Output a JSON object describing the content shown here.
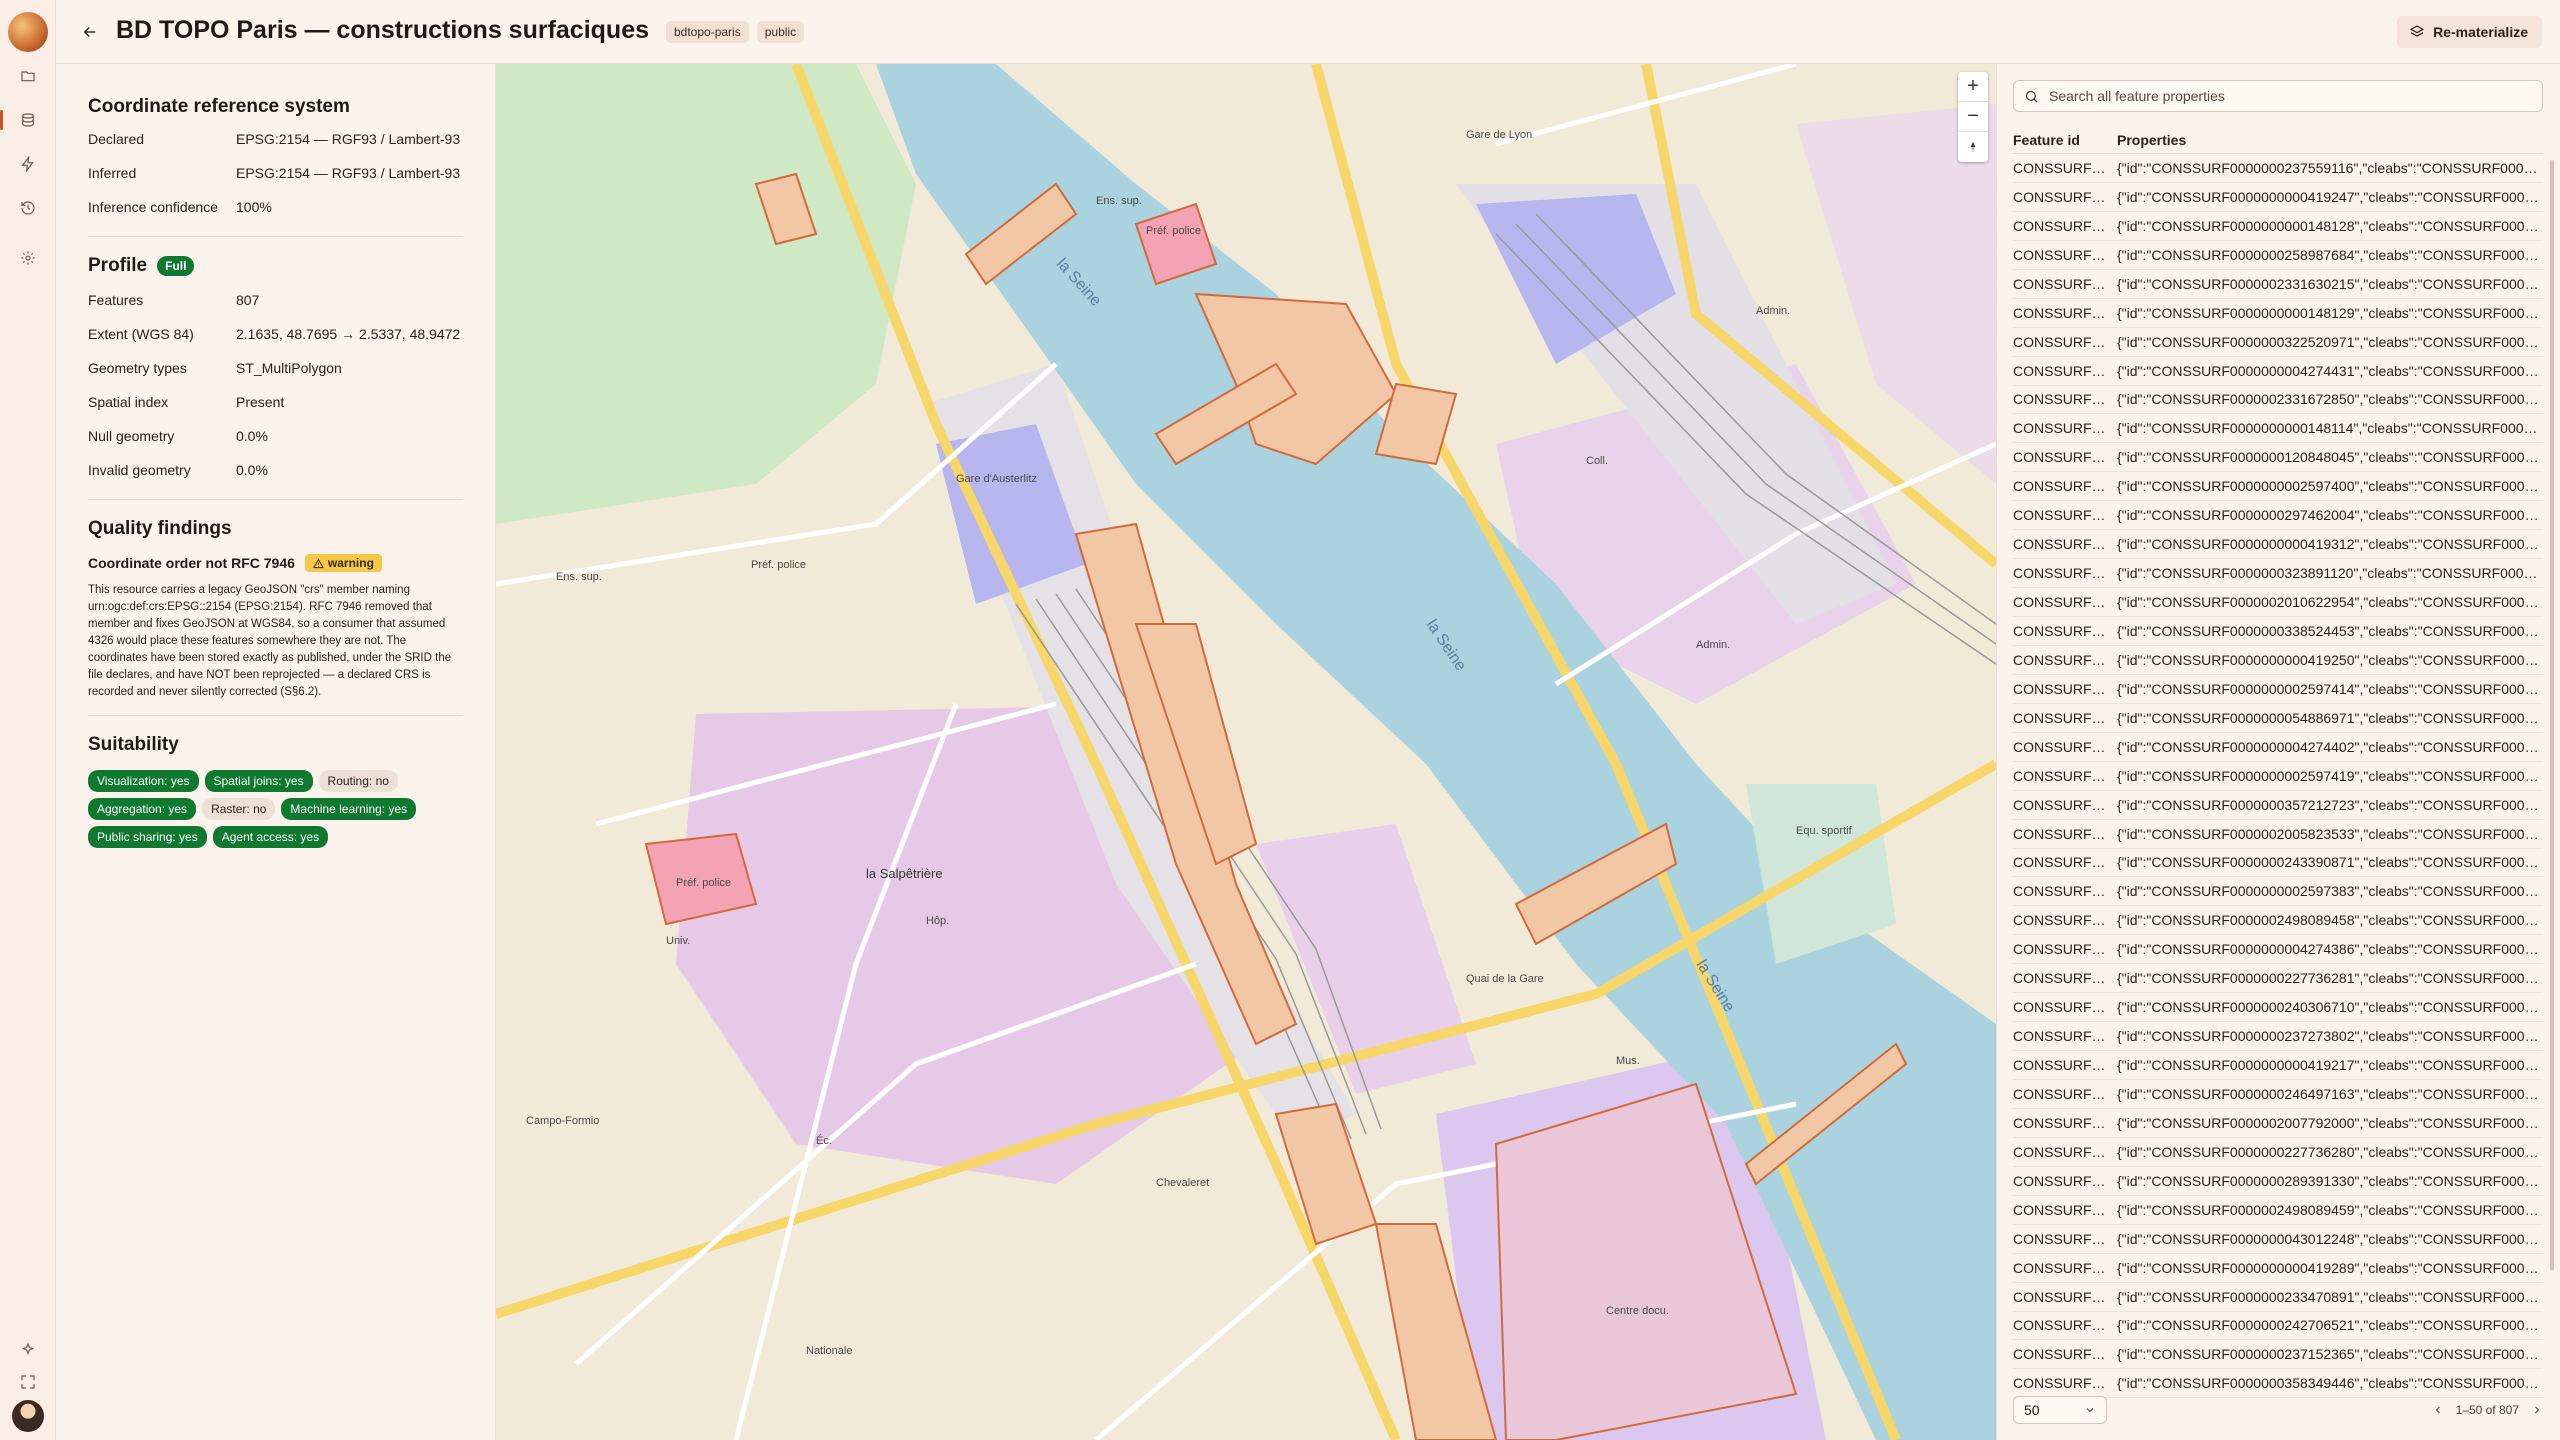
{
  "header": {
    "title": "BD TOPO Paris — constructions surfaciques",
    "chips": [
      "bdtopo-paris",
      "public"
    ],
    "rematerialize_label": "Re-materialize"
  },
  "crs": {
    "title": "Coordinate reference system",
    "rows": [
      {
        "k": "Declared",
        "v": "EPSG:2154 — RGF93 / Lambert-93"
      },
      {
        "k": "Inferred",
        "v": "EPSG:2154 — RGF93 / Lambert-93"
      },
      {
        "k": "Inference confidence",
        "v": "100%"
      }
    ]
  },
  "profile": {
    "title": "Profile",
    "badge": "Full",
    "rows": [
      {
        "k": "Features",
        "v": "807"
      },
      {
        "k": "Extent (WGS 84)",
        "v": "2.1635, 48.7695 → 2.5337, 48.9472"
      },
      {
        "k": "Geometry types",
        "v": "ST_MultiPolygon"
      },
      {
        "k": "Spatial index",
        "v": "Present"
      },
      {
        "k": "Null geometry",
        "v": "0.0%"
      },
      {
        "k": "Invalid geometry",
        "v": "0.0%"
      }
    ]
  },
  "quality": {
    "title": "Quality findings",
    "finding_title": "Coordinate order not RFC 7946",
    "finding_badge": "warning",
    "finding_body": "This resource carries a legacy GeoJSON \"crs\" member naming urn:ogc:def:crs:EPSG::2154 (EPSG:2154). RFC 7946 removed that member and fixes GeoJSON at WGS84, so a consumer that assumed 4326 would place these features somewhere they are not. The coordinates have been stored exactly as published, under the SRID the file declares, and have NOT been reprojected — a declared CRS is recorded and never silently corrected (S§6.2)."
  },
  "suitability": {
    "title": "Suitability",
    "items": [
      {
        "label": "Visualization: yes",
        "ok": true
      },
      {
        "label": "Spatial joins: yes",
        "ok": true
      },
      {
        "label": "Routing: no",
        "ok": false
      },
      {
        "label": "Aggregation: yes",
        "ok": true
      },
      {
        "label": "Raster: no",
        "ok": false
      },
      {
        "label": "Machine learning: yes",
        "ok": true
      },
      {
        "label": "Public sharing: yes",
        "ok": true
      },
      {
        "label": "Agent access: yes",
        "ok": true
      }
    ]
  },
  "map": {
    "zoom_in": "+",
    "zoom_out": "−",
    "labels": [
      {
        "t": "la Seine"
      },
      {
        "t": "la Seine"
      },
      {
        "t": "la Seine"
      },
      {
        "t": "la Salpêtrière"
      },
      {
        "t": "Gare d'Austerlitz"
      },
      {
        "t": "Préf. police"
      },
      {
        "t": "Préf. police"
      },
      {
        "t": "Préf. police"
      },
      {
        "t": "Equ. sportif"
      },
      {
        "t": "Centre docu."
      },
      {
        "t": "Admin."
      },
      {
        "t": "Admin."
      },
      {
        "t": "Ens. sup."
      },
      {
        "t": "Ens. sup."
      },
      {
        "t": "Mus."
      },
      {
        "t": "Coll."
      },
      {
        "t": "Gare de Lyon"
      },
      {
        "t": "Quai de la Gare"
      },
      {
        "t": "Chevaleret"
      },
      {
        "t": "Nationale"
      },
      {
        "t": "Campo-Formio"
      },
      {
        "t": "Éc."
      },
      {
        "t": "Hôp."
      },
      {
        "t": "Univ."
      }
    ]
  },
  "table": {
    "search_placeholder": "Search all feature properties",
    "col_id": "Feature id",
    "col_props": "Properties",
    "rows": [
      {
        "id": "CONSSURF…",
        "p": "{\"id\":\"CONSSURF0000000237559116\",\"cleabs\":\"CONSSURF00000…"
      },
      {
        "id": "CONSSURF…",
        "p": "{\"id\":\"CONSSURF0000000000419247\",\"cleabs\":\"CONSSURF00000…"
      },
      {
        "id": "CONSSURF…",
        "p": "{\"id\":\"CONSSURF0000000000148128\",\"cleabs\":\"CONSSURF00000…"
      },
      {
        "id": "CONSSURF…",
        "p": "{\"id\":\"CONSSURF0000000258987684\",\"cleabs\":\"CONSSURF00000…"
      },
      {
        "id": "CONSSURF…",
        "p": "{\"id\":\"CONSSURF0000002331630215\",\"cleabs\":\"CONSSURF00000…"
      },
      {
        "id": "CONSSURF…",
        "p": "{\"id\":\"CONSSURF0000000000148129\",\"cleabs\":\"CONSSURF00000…"
      },
      {
        "id": "CONSSURF…",
        "p": "{\"id\":\"CONSSURF0000000322520971\",\"cleabs\":\"CONSSURF00000…"
      },
      {
        "id": "CONSSURF…",
        "p": "{\"id\":\"CONSSURF0000000004274431\",\"cleabs\":\"CONSSURF00000…"
      },
      {
        "id": "CONSSURF…",
        "p": "{\"id\":\"CONSSURF0000002331672850\",\"cleabs\":\"CONSSURF00000…"
      },
      {
        "id": "CONSSURF…",
        "p": "{\"id\":\"CONSSURF0000000000148114\",\"cleabs\":\"CONSSURF00000…"
      },
      {
        "id": "CONSSURF…",
        "p": "{\"id\":\"CONSSURF0000000120848045\",\"cleabs\":\"CONSSURF00000…"
      },
      {
        "id": "CONSSURF…",
        "p": "{\"id\":\"CONSSURF0000000002597400\",\"cleabs\":\"CONSSURF00000…"
      },
      {
        "id": "CONSSURF…",
        "p": "{\"id\":\"CONSSURF0000000297462004\",\"cleabs\":\"CONSSURF00000…"
      },
      {
        "id": "CONSSURF…",
        "p": "{\"id\":\"CONSSURF0000000000419312\",\"cleabs\":\"CONSSURF00000…"
      },
      {
        "id": "CONSSURF…",
        "p": "{\"id\":\"CONSSURF0000000323891120\",\"cleabs\":\"CONSSURF00000…"
      },
      {
        "id": "CONSSURF…",
        "p": "{\"id\":\"CONSSURF0000002010622954\",\"cleabs\":\"CONSSURF00000…"
      },
      {
        "id": "CONSSURF…",
        "p": "{\"id\":\"CONSSURF0000000338524453\",\"cleabs\":\"CONSSURF00000…"
      },
      {
        "id": "CONSSURF…",
        "p": "{\"id\":\"CONSSURF0000000000419250\",\"cleabs\":\"CONSSURF00000…"
      },
      {
        "id": "CONSSURF…",
        "p": "{\"id\":\"CONSSURF0000000002597414\",\"cleabs\":\"CONSSURF00000…"
      },
      {
        "id": "CONSSURF…",
        "p": "{\"id\":\"CONSSURF0000000054886971\",\"cleabs\":\"CONSSURF00000…"
      },
      {
        "id": "CONSSURF…",
        "p": "{\"id\":\"CONSSURF0000000004274402\",\"cleabs\":\"CONSSURF00000…"
      },
      {
        "id": "CONSSURF…",
        "p": "{\"id\":\"CONSSURF0000000002597419\",\"cleabs\":\"CONSSURF00000…"
      },
      {
        "id": "CONSSURF…",
        "p": "{\"id\":\"CONSSURF0000000357212723\",\"cleabs\":\"CONSSURF00000…"
      },
      {
        "id": "CONSSURF…",
        "p": "{\"id\":\"CONSSURF0000002005823533\",\"cleabs\":\"CONSSURF00000…"
      },
      {
        "id": "CONSSURF…",
        "p": "{\"id\":\"CONSSURF0000000243390871\",\"cleabs\":\"CONSSURF00000…"
      },
      {
        "id": "CONSSURF…",
        "p": "{\"id\":\"CONSSURF0000000002597383\",\"cleabs\":\"CONSSURF00000…"
      },
      {
        "id": "CONSSURF…",
        "p": "{\"id\":\"CONSSURF0000002498089458\",\"cleabs\":\"CONSSURF00000…"
      },
      {
        "id": "CONSSURF…",
        "p": "{\"id\":\"CONSSURF0000000004274386\",\"cleabs\":\"CONSSURF00000…"
      },
      {
        "id": "CONSSURF…",
        "p": "{\"id\":\"CONSSURF0000000227736281\",\"cleabs\":\"CONSSURF00000…"
      },
      {
        "id": "CONSSURF…",
        "p": "{\"id\":\"CONSSURF0000000240306710\",\"cleabs\":\"CONSSURF00000…"
      },
      {
        "id": "CONSSURF…",
        "p": "{\"id\":\"CONSSURF0000000237273802\",\"cleabs\":\"CONSSURF00000…"
      },
      {
        "id": "CONSSURF…",
        "p": "{\"id\":\"CONSSURF0000000000419217\",\"cleabs\":\"CONSSURF00000…"
      },
      {
        "id": "CONSSURF…",
        "p": "{\"id\":\"CONSSURF0000000246497163\",\"cleabs\":\"CONSSURF00000…"
      },
      {
        "id": "CONSSURF…",
        "p": "{\"id\":\"CONSSURF0000002007792000\",\"cleabs\":\"CONSSURF00000…"
      },
      {
        "id": "CONSSURF…",
        "p": "{\"id\":\"CONSSURF0000000227736280\",\"cleabs\":\"CONSSURF00000…"
      },
      {
        "id": "CONSSURF…",
        "p": "{\"id\":\"CONSSURF0000000289391330\",\"cleabs\":\"CONSSURF00000…"
      },
      {
        "id": "CONSSURF…",
        "p": "{\"id\":\"CONSSURF0000002498089459\",\"cleabs\":\"CONSSURF00000…"
      },
      {
        "id": "CONSSURF…",
        "p": "{\"id\":\"CONSSURF0000000043012248\",\"cleabs\":\"CONSSURF00000…"
      },
      {
        "id": "CONSSURF…",
        "p": "{\"id\":\"CONSSURF0000000000419289\",\"cleabs\":\"CONSSURF00000…"
      },
      {
        "id": "CONSSURF…",
        "p": "{\"id\":\"CONSSURF0000000233470891\",\"cleabs\":\"CONSSURF00000…"
      },
      {
        "id": "CONSSURF…",
        "p": "{\"id\":\"CONSSURF0000000242706521\",\"cleabs\":\"CONSSURF00000…"
      },
      {
        "id": "CONSSURF…",
        "p": "{\"id\":\"CONSSURF0000000237152365\",\"cleabs\":\"CONSSURF00000…"
      },
      {
        "id": "CONSSURF…",
        "p": "{\"id\":\"CONSSURF0000000358349446\",\"cleabs\":\"CONSSURF00000…"
      }
    ],
    "page_size": "50",
    "page_info": "1–50 of 807"
  },
  "colors": {
    "accent": "#c2552b",
    "ok": "#0f7a2f",
    "warn": "#f6c84a",
    "water": "#aad3df",
    "feature_stroke": "#d26a3a"
  }
}
